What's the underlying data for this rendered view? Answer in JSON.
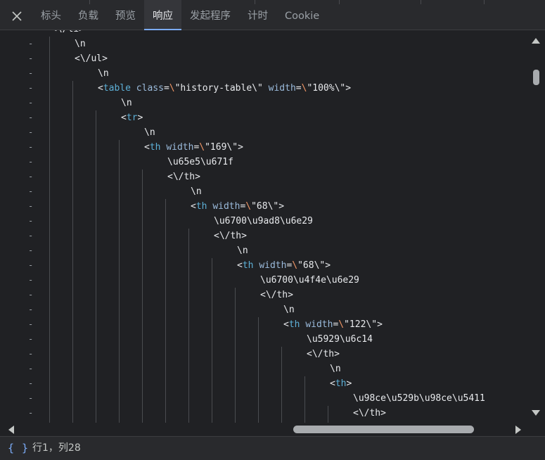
{
  "tabs": [
    {
      "label": "标头",
      "active": false
    },
    {
      "label": "负载",
      "active": false
    },
    {
      "label": "预览",
      "active": false
    },
    {
      "label": "响应",
      "active": true
    },
    {
      "label": "发起程序",
      "active": false
    },
    {
      "label": "计时",
      "active": false
    },
    {
      "label": "Cookie",
      "active": false
    }
  ],
  "close_icon": "close-icon",
  "code": {
    "fold_marker": "-",
    "lines": [
      {
        "depth": 0,
        "fold": false,
        "tokens": [
          {
            "t": "<\\/li>",
            "c": "c-val"
          }
        ]
      },
      {
        "depth": 1,
        "fold": true,
        "tokens": [
          {
            "t": "\\n",
            "c": "c-val"
          }
        ]
      },
      {
        "depth": 1,
        "fold": true,
        "tokens": [
          {
            "t": "<\\/ul>",
            "c": "c-val"
          }
        ]
      },
      {
        "depth": 2,
        "fold": true,
        "tokens": [
          {
            "t": "\\n",
            "c": "c-val"
          }
        ]
      },
      {
        "depth": 2,
        "fold": true,
        "tokens": [
          {
            "t": "<",
            "c": "c-val"
          },
          {
            "t": "table",
            "c": "c-tag"
          },
          {
            "t": " ",
            "c": "c-val"
          },
          {
            "t": "class",
            "c": "c-attr"
          },
          {
            "t": "=",
            "c": "c-eq"
          },
          {
            "t": "\\",
            "c": "c-esc"
          },
          {
            "t": "\"history-table\\\" ",
            "c": "c-val"
          },
          {
            "t": "width",
            "c": "c-attr"
          },
          {
            "t": "=",
            "c": "c-eq"
          },
          {
            "t": "\\",
            "c": "c-esc"
          },
          {
            "t": "\"100%\\\">",
            "c": "c-val"
          }
        ]
      },
      {
        "depth": 3,
        "fold": true,
        "tokens": [
          {
            "t": "\\n",
            "c": "c-val"
          }
        ]
      },
      {
        "depth": 3,
        "fold": true,
        "tokens": [
          {
            "t": "<",
            "c": "c-val"
          },
          {
            "t": "tr",
            "c": "c-tag"
          },
          {
            "t": ">",
            "c": "c-val"
          }
        ]
      },
      {
        "depth": 4,
        "fold": true,
        "tokens": [
          {
            "t": "\\n",
            "c": "c-val"
          }
        ]
      },
      {
        "depth": 4,
        "fold": true,
        "tokens": [
          {
            "t": "<",
            "c": "c-val"
          },
          {
            "t": "th",
            "c": "c-tag"
          },
          {
            "t": " ",
            "c": "c-val"
          },
          {
            "t": "width",
            "c": "c-attr"
          },
          {
            "t": "=",
            "c": "c-eq"
          },
          {
            "t": "\\",
            "c": "c-esc"
          },
          {
            "t": "\"169\\\">",
            "c": "c-val"
          }
        ]
      },
      {
        "depth": 5,
        "fold": true,
        "tokens": [
          {
            "t": "\\u65e5\\u671f",
            "c": "c-val"
          }
        ]
      },
      {
        "depth": 5,
        "fold": true,
        "tokens": [
          {
            "t": "<\\/th>",
            "c": "c-val"
          }
        ]
      },
      {
        "depth": 6,
        "fold": true,
        "tokens": [
          {
            "t": "\\n",
            "c": "c-val"
          }
        ]
      },
      {
        "depth": 6,
        "fold": true,
        "tokens": [
          {
            "t": "<",
            "c": "c-val"
          },
          {
            "t": "th",
            "c": "c-tag"
          },
          {
            "t": " ",
            "c": "c-val"
          },
          {
            "t": "width",
            "c": "c-attr"
          },
          {
            "t": "=",
            "c": "c-eq"
          },
          {
            "t": "\\",
            "c": "c-esc"
          },
          {
            "t": "\"68\\\">",
            "c": "c-val"
          }
        ]
      },
      {
        "depth": 7,
        "fold": true,
        "tokens": [
          {
            "t": "\\u6700\\u9ad8\\u6e29",
            "c": "c-val"
          }
        ]
      },
      {
        "depth": 7,
        "fold": true,
        "tokens": [
          {
            "t": "<\\/th>",
            "c": "c-val"
          }
        ]
      },
      {
        "depth": 8,
        "fold": true,
        "tokens": [
          {
            "t": "\\n",
            "c": "c-val"
          }
        ]
      },
      {
        "depth": 8,
        "fold": true,
        "tokens": [
          {
            "t": "<",
            "c": "c-val"
          },
          {
            "t": "th",
            "c": "c-tag"
          },
          {
            "t": " ",
            "c": "c-val"
          },
          {
            "t": "width",
            "c": "c-attr"
          },
          {
            "t": "=",
            "c": "c-eq"
          },
          {
            "t": "\\",
            "c": "c-esc"
          },
          {
            "t": "\"68\\\">",
            "c": "c-val"
          }
        ]
      },
      {
        "depth": 9,
        "fold": true,
        "tokens": [
          {
            "t": "\\u6700\\u4f4e\\u6e29",
            "c": "c-val"
          }
        ]
      },
      {
        "depth": 9,
        "fold": true,
        "tokens": [
          {
            "t": "<\\/th>",
            "c": "c-val"
          }
        ]
      },
      {
        "depth": 10,
        "fold": true,
        "tokens": [
          {
            "t": "\\n",
            "c": "c-val"
          }
        ]
      },
      {
        "depth": 10,
        "fold": true,
        "tokens": [
          {
            "t": "<",
            "c": "c-val"
          },
          {
            "t": "th",
            "c": "c-tag"
          },
          {
            "t": " ",
            "c": "c-val"
          },
          {
            "t": "width",
            "c": "c-attr"
          },
          {
            "t": "=",
            "c": "c-eq"
          },
          {
            "t": "\\",
            "c": "c-esc"
          },
          {
            "t": "\"122\\\">",
            "c": "c-val"
          }
        ]
      },
      {
        "depth": 11,
        "fold": true,
        "tokens": [
          {
            "t": "\\u5929\\u6c14",
            "c": "c-val"
          }
        ]
      },
      {
        "depth": 11,
        "fold": true,
        "tokens": [
          {
            "t": "<\\/th>",
            "c": "c-val"
          }
        ]
      },
      {
        "depth": 12,
        "fold": true,
        "tokens": [
          {
            "t": "\\n",
            "c": "c-val"
          }
        ]
      },
      {
        "depth": 12,
        "fold": true,
        "tokens": [
          {
            "t": "<",
            "c": "c-val"
          },
          {
            "t": "th",
            "c": "c-tag"
          },
          {
            "t": ">",
            "c": "c-val"
          }
        ]
      },
      {
        "depth": 13,
        "fold": true,
        "tokens": [
          {
            "t": "\\u98ce\\u529b\\u98ce\\u5411",
            "c": "c-val"
          }
        ]
      },
      {
        "depth": 13,
        "fold": true,
        "tokens": [
          {
            "t": "<\\/th>",
            "c": "c-val"
          }
        ]
      }
    ]
  },
  "status": {
    "format_icon": "{ }",
    "cursor_position": "行1，列28"
  },
  "colors": {
    "accent": "#7cacf8",
    "tag": "#5db0d7",
    "attr": "#9bbbdc",
    "escape": "#f29766",
    "background": "#202124"
  }
}
